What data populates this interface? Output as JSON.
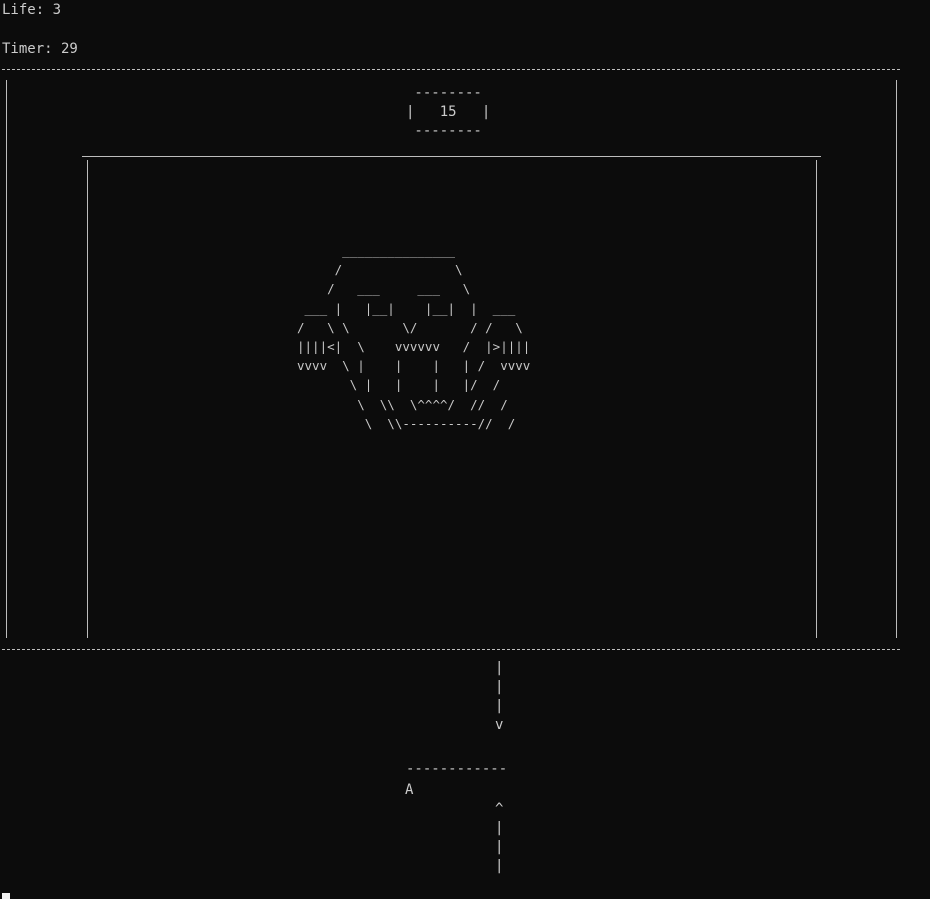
{
  "hud": {
    "life_label": "Life: 3",
    "timer_label": "Timer: 29"
  },
  "boss": {
    "hp_box": " --------\n|   15   |\n --------",
    "sprite": "      _______________\n     /               \\\n    /   ___     ___   \\\n ___ |   |__|    |__|  |  ___\n/   \\ \\       \\/       / /   \\\n||||<|  \\    vvvvvv   /  |>||||\nvvvv  \\ |    |    |   | /  vvvv\n       \\ |   |    |   |/  /\n        \\  \\\\  \\^^^^/  //  /\n         \\  \\\\----------//  /"
  },
  "projectiles": {
    "incoming": "|\n|\n|\nv",
    "outgoing": "^\n|\n|\n|"
  },
  "player": {
    "paddle": "------------",
    "ship": "A"
  },
  "colors": {
    "background": "#0c0c0c",
    "text": "#cccccc"
  }
}
